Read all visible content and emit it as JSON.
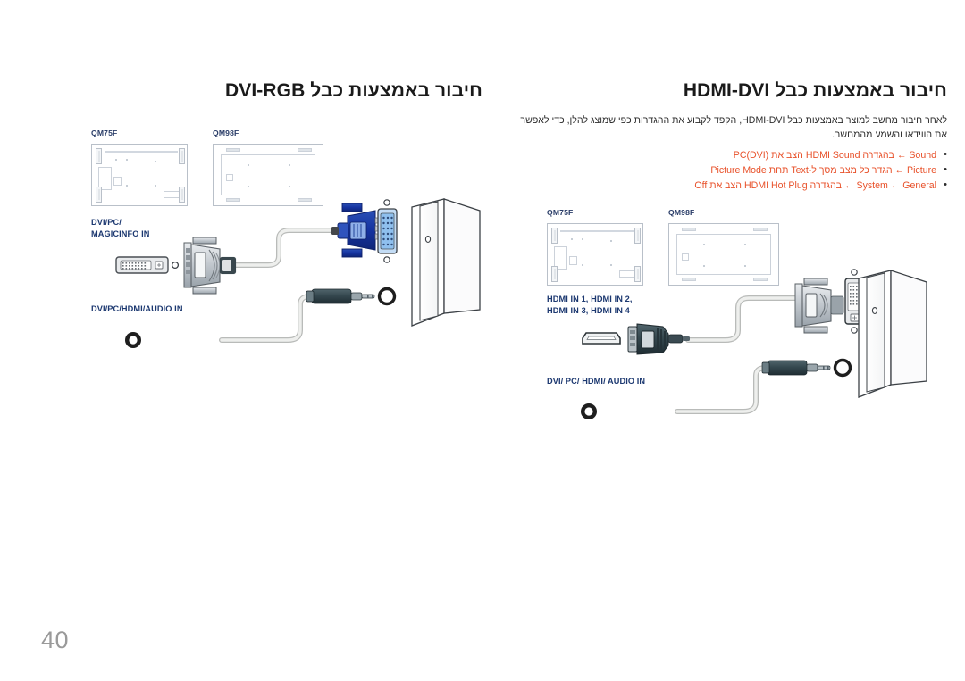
{
  "page": {
    "number": "40",
    "background": "#ffffff",
    "accent_red": "#e8512a",
    "label_blue": "#1c3870",
    "text_dark": "#2b2b2b"
  },
  "sections": [
    {
      "id": "dvi-rgb",
      "title": "חיבור באמצעות כבל DVI-RGB",
      "devices": [
        {
          "name": "QM75F"
        },
        {
          "name": "QM98F"
        }
      ],
      "port_labels": [
        "DVI/PC/",
        "MAGICINFO IN",
        "DVI/PC/HDMI/AUDIO IN"
      ],
      "connectors": [
        "dvi-port-icon",
        "dvi-to-vga-connector-icon",
        "vga-blue-plug-icon",
        "vga-port-icon",
        "audio-jack-port-icon",
        "audio-jack-plug-icon",
        "pc-tower-icon"
      ]
    },
    {
      "id": "hdmi-dvi",
      "title": "חיבור באמצעות כבל HDMI-DVI",
      "intro": "לאחר חיבור מחשב למוצר באמצעות כבל HDMI-DVI, הקפד לקבוע את ההגדרות כפי שמוצג להלן, כדי לאפשר את הווידאו והשמע מהמחשב.",
      "bullets": [
        "Sound ← בהגדרה HDMI Sound הצב את PC(DVI)",
        "Picture ← הגדר כל מצב מסך ל-Text תחת Picture Mode",
        "System ← General ← בהגדרה HDMI Hot Plug הצב את Off"
      ],
      "devices": [
        {
          "name": "QM75F"
        },
        {
          "name": "QM98F"
        }
      ],
      "port_labels": [
        "HDMI IN 1, HDMI IN 2,",
        "HDMI IN 3, HDMI IN 4",
        "DVI/ PC/ HDMI/ AUDIO IN"
      ],
      "connectors": [
        "hdmi-port-icon",
        "hdmi-plug-icon",
        "dvi-plug-icon",
        "dvi-port-icon",
        "audio-jack-port-icon",
        "audio-jack-plug-icon",
        "pc-tower-icon"
      ]
    }
  ]
}
